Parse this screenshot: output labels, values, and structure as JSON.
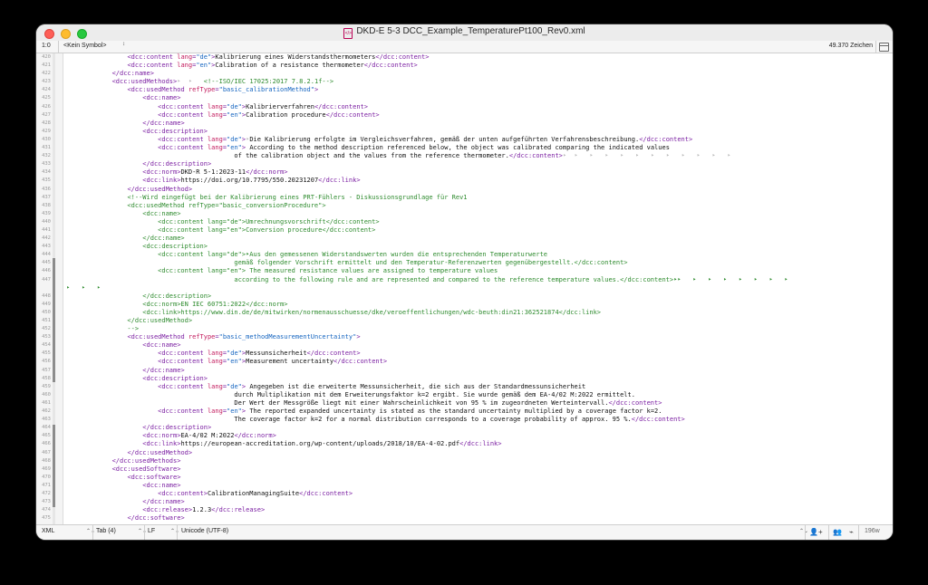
{
  "window": {
    "title": "DKD-E 5-3 DCC_Example_TemperaturePt100_Rev0.xml",
    "file_icon_label": "</>"
  },
  "navbar": {
    "position": "1:0",
    "symbol": "<Kein Symbol>",
    "updown": "↕",
    "char_count": "49.370 Zeichen"
  },
  "statusbar": {
    "syntax": "XML",
    "tab": "Tab (4)",
    "line_endings": "LF",
    "encoding": "Unicode (UTF-8)",
    "word_count": "196w",
    "select_arrows": "⌃⌄"
  },
  "colors": {
    "tag": "#7b1fa2",
    "attribute": "#c2185b",
    "value": "#1565c0",
    "comment": "#2e8b2e",
    "link": "#1a3fd0"
  },
  "lines": [
    {
      "n": "420",
      "text": "                <dcc:content lang=\"de\">Kalibrierung eines Widerstandsthermometers</dcc:content>"
    },
    {
      "n": "421",
      "text": "                <dcc:content lang=\"en\">Calibration of a resistance thermometer</dcc:content>"
    },
    {
      "n": "422",
      "text": "            </dcc:name>"
    },
    {
      "n": "423",
      "text": "            <dcc:usedMethods>‣  ‣   <!--ISO/IEC 17025:2017 7.8.2.1f-->"
    },
    {
      "n": "424",
      "text": "                <dcc:usedMethod refType=\"basic_calibrationMethod\">"
    },
    {
      "n": "425",
      "text": "                    <dcc:name>"
    },
    {
      "n": "426",
      "text": "                        <dcc:content lang=\"de\">Kalibrierverfahren</dcc:content>"
    },
    {
      "n": "427",
      "text": "                        <dcc:content lang=\"en\">Calibration procedure</dcc:content>"
    },
    {
      "n": "428",
      "text": "                    </dcc:name>"
    },
    {
      "n": "429",
      "text": "                    <dcc:description>"
    },
    {
      "n": "430",
      "text": "                        <dcc:content lang=\"de\">‣Die Kalibrierung erfolgte im Vergleichsverfahren, gemäß der unten aufgeführten Verfahrensbeschreibung.</dcc:content>"
    },
    {
      "n": "431",
      "text": "                        <dcc:content lang=\"en\"> According to the method description referenced below, the object was calibrated comparing the indicated values"
    },
    {
      "n": "432",
      "text": "                                            of the calibration object and the values from the reference thermometer.</dcc:content>‣  ‣   ‣   ‣   ‣   ‣   ‣   ‣   ‣   ‣   ‣   ‣"
    },
    {
      "n": "433",
      "text": "                    </dcc:description>"
    },
    {
      "n": "434",
      "text": "                    <dcc:norm>DKD-R 5-1:2023-11</dcc:norm>"
    },
    {
      "n": "435",
      "text": "                    <dcc:link>https://doi.org/10.7795/550.20231207</dcc:link>"
    },
    {
      "n": "436",
      "text": "                </dcc:usedMethod>"
    },
    {
      "n": "437",
      "text": "                <!--Wird eingefügt bei der Kalibrierung eines PRT-Fühlers - Diskussionsgrundlage für Rev1"
    },
    {
      "n": "438",
      "text": "                <dcc:usedMethod refType=\"basic_conversionProcedure\">"
    },
    {
      "n": "439",
      "text": "                    <dcc:name>"
    },
    {
      "n": "440",
      "text": "                        <dcc:content lang=\"de\">Umrechnungsvorschrift</dcc:content>"
    },
    {
      "n": "441",
      "text": "                        <dcc:content lang=\"en\">Conversion procedure</dcc:content>"
    },
    {
      "n": "442",
      "text": "                    </dcc:name>"
    },
    {
      "n": "443",
      "text": "                    <dcc:description>"
    },
    {
      "n": "444",
      "text": "                        <dcc:content lang=\"de\">‣Aus den gemessenen Widerstandswerten wurden die entsprechenden Temperaturwerte"
    },
    {
      "n": "445",
      "text": "                                            gemäß folgender Vorschrift ermittelt und den Temperatur-Referenzwerten gegenübergestellt.</dcc:content>"
    },
    {
      "n": "446",
      "text": "                        <dcc:content lang=\"en\"> The measured resistance values are assigned to temperature values"
    },
    {
      "n": "447",
      "text": "                                            according to the following rule and are represented and compared to the reference temperature values.</dcc:content>‣‣   ‣   ‣   ‣   ‣   ‣   ‣   ‣"
    },
    {
      "n": "",
      "text": "‣   ‣   ‣"
    },
    {
      "n": "448",
      "text": "                    </dcc:description>"
    },
    {
      "n": "449",
      "text": "                    <dcc:norm>EN IEC 60751:2022</dcc:norm>"
    },
    {
      "n": "450",
      "text": "                    <dcc:link>https://www.din.de/de/mitwirken/normenausschuesse/dke/veroeffentlichungen/wdc-beuth:din21:362521874</dcc:link>"
    },
    {
      "n": "451",
      "text": "                </dcc:usedMethod>"
    },
    {
      "n": "452",
      "text": "                -->"
    },
    {
      "n": "453",
      "text": "                <dcc:usedMethod refType=\"basic_methodMeasurementUncertainty\">"
    },
    {
      "n": "454",
      "text": "                    <dcc:name>"
    },
    {
      "n": "455",
      "text": "                        <dcc:content lang=\"de\">Messunsicherheit</dcc:content>"
    },
    {
      "n": "456",
      "text": "                        <dcc:content lang=\"en\">Measurement uncertainty</dcc:content>"
    },
    {
      "n": "457",
      "text": "                    </dcc:name>"
    },
    {
      "n": "458",
      "text": "                    <dcc:description>"
    },
    {
      "n": "459",
      "text": "                        <dcc:content lang=\"de\"> Angegeben ist die erweiterte Messunsicherheit, die sich aus der Standardmessunsicherheit"
    },
    {
      "n": "460",
      "text": "                                            durch Multiplikation mit dem Erweiterungsfaktor k=2 ergibt. Sie wurde gemäß dem EA-4/02 M:2022 ermittelt."
    },
    {
      "n": "461",
      "text": "                                            Der Wert der Messgröße liegt mit einer Wahrscheinlichkeit von 95 % im zugeordneten Werteintervall.</dcc:content>"
    },
    {
      "n": "462",
      "text": "                        <dcc:content lang=\"en\"> The reported expanded uncertainty is stated as the standard uncertainty multiplied by a coverage factor k=2."
    },
    {
      "n": "463",
      "text": "                                            The coverage factor k=2 for a normal distribution corresponds to a coverage probability of approx. 95 %.</dcc:content>"
    },
    {
      "n": "464",
      "text": "                    </dcc:description>"
    },
    {
      "n": "465",
      "text": "                    <dcc:norm>EA-4/02 M:2022</dcc:norm>"
    },
    {
      "n": "466",
      "text": "                    <dcc:link>https://european-accreditation.org/wp-content/uploads/2018/10/EA-4-02.pdf</dcc:link>"
    },
    {
      "n": "467",
      "text": "                </dcc:usedMethod>"
    },
    {
      "n": "468",
      "text": "            </dcc:usedMethods>"
    },
    {
      "n": "469",
      "text": "            <dcc:usedSoftware>"
    },
    {
      "n": "470",
      "text": "                <dcc:software>"
    },
    {
      "n": "471",
      "text": "                    <dcc:name>"
    },
    {
      "n": "472",
      "text": "                        <dcc:content>CalibrationManagingSuite</dcc:content>"
    },
    {
      "n": "473",
      "text": "                    </dcc:name>"
    },
    {
      "n": "474",
      "text": "                    <dcc:release>1.2.3</dcc:release>"
    },
    {
      "n": "475",
      "text": "                </dcc:software>"
    }
  ]
}
